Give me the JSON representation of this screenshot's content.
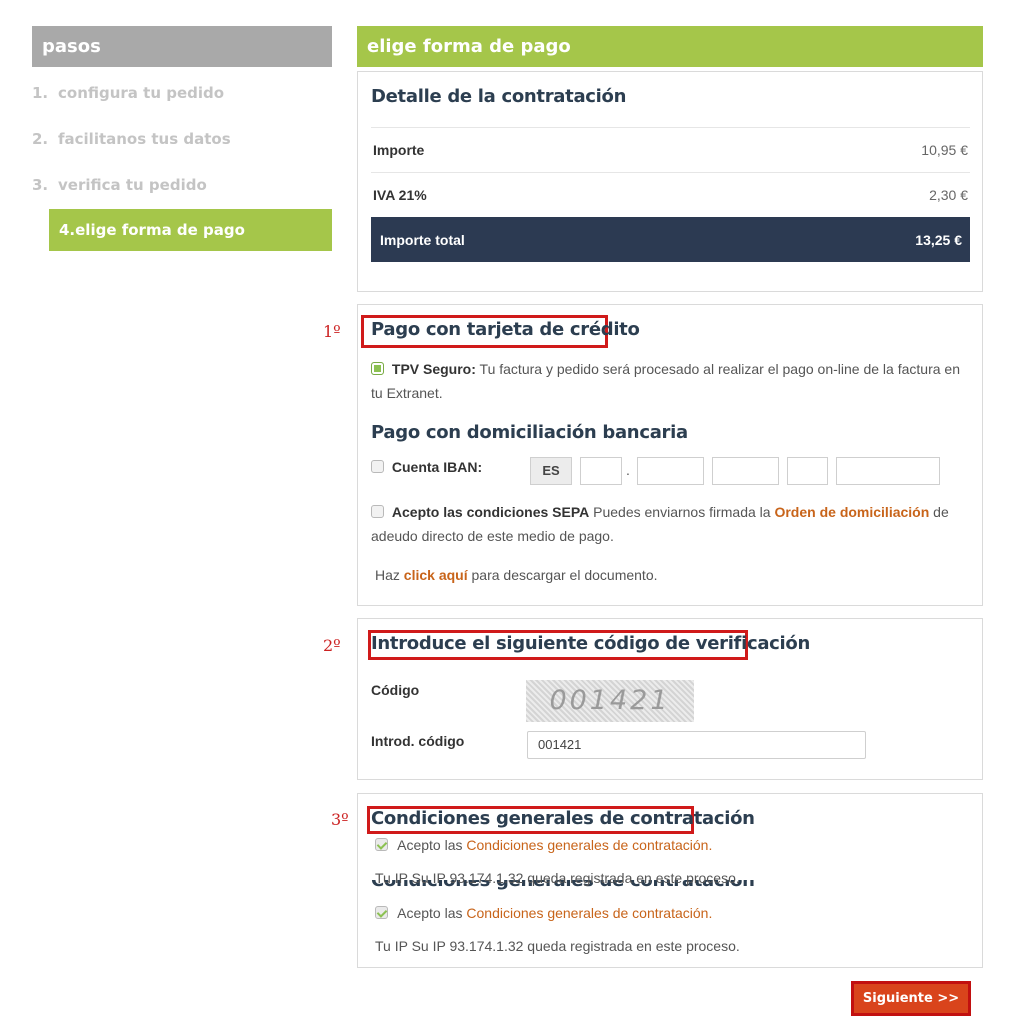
{
  "sidebar": {
    "header": "pasos",
    "steps": [
      {
        "num": "1.",
        "label": "configura tu pedido"
      },
      {
        "num": "2.",
        "label": "facilitanos tus datos"
      },
      {
        "num": "3.",
        "label": "verifica tu pedido"
      }
    ],
    "active_step": "4.elige forma de pago"
  },
  "main": {
    "header": "elige forma de pago",
    "summary": {
      "title": "Detalle de la contratación",
      "rows": [
        {
          "label": "Importe",
          "value": "10,95 €"
        },
        {
          "label": "IVA 21%",
          "value": "2,30 €"
        }
      ],
      "total_label": "Importe total",
      "total_value": "13,25 €"
    },
    "card": {
      "marker": "1º",
      "title": "Pago con tarjeta de crédito",
      "tpv_label": "TPV Seguro:",
      "tpv_text": "Tu factura y pedido será procesado al realizar el pago on-line de la factura en",
      "tpv_text2": "tu Extranet."
    },
    "bank": {
      "title": "Pago con domiciliación bancaria",
      "iban_label": "Cuenta IBAN:",
      "iban_country": "ES",
      "iban_dot": ".",
      "sepa_label": "Acepto las condiciones SEPA",
      "sepa_text1": "Puedes enviarnos firmada la",
      "sepa_link": "Orden de domiciliación",
      "sepa_text2": "de",
      "sepa_text3": "adeudo directo de este medio de pago.",
      "haz": "Haz",
      "click_link": "click aquí",
      "download_text": "para descargar el documento."
    },
    "verify": {
      "marker": "2º",
      "title": "Introduce el siguiente código de verificación",
      "code_label": "Código",
      "captcha": "001421",
      "input_label": "Introd. código",
      "input_value": "001421"
    },
    "conditions": {
      "marker": "3º",
      "title": "Condiciones generales de contratación",
      "accept_prefix": "Acepto las",
      "accept_link": "Condiciones generales de contratación.",
      "ip_text": "Tu IP Su IP 93.174.1.32 queda registrada en este proceso."
    },
    "next_button": "Siguiente >>"
  },
  "colors": {
    "green": "#a5c64a",
    "dark_navy": "#2c3a52",
    "orange_link": "#c8641a",
    "red_highlight": "#d01a1a"
  }
}
